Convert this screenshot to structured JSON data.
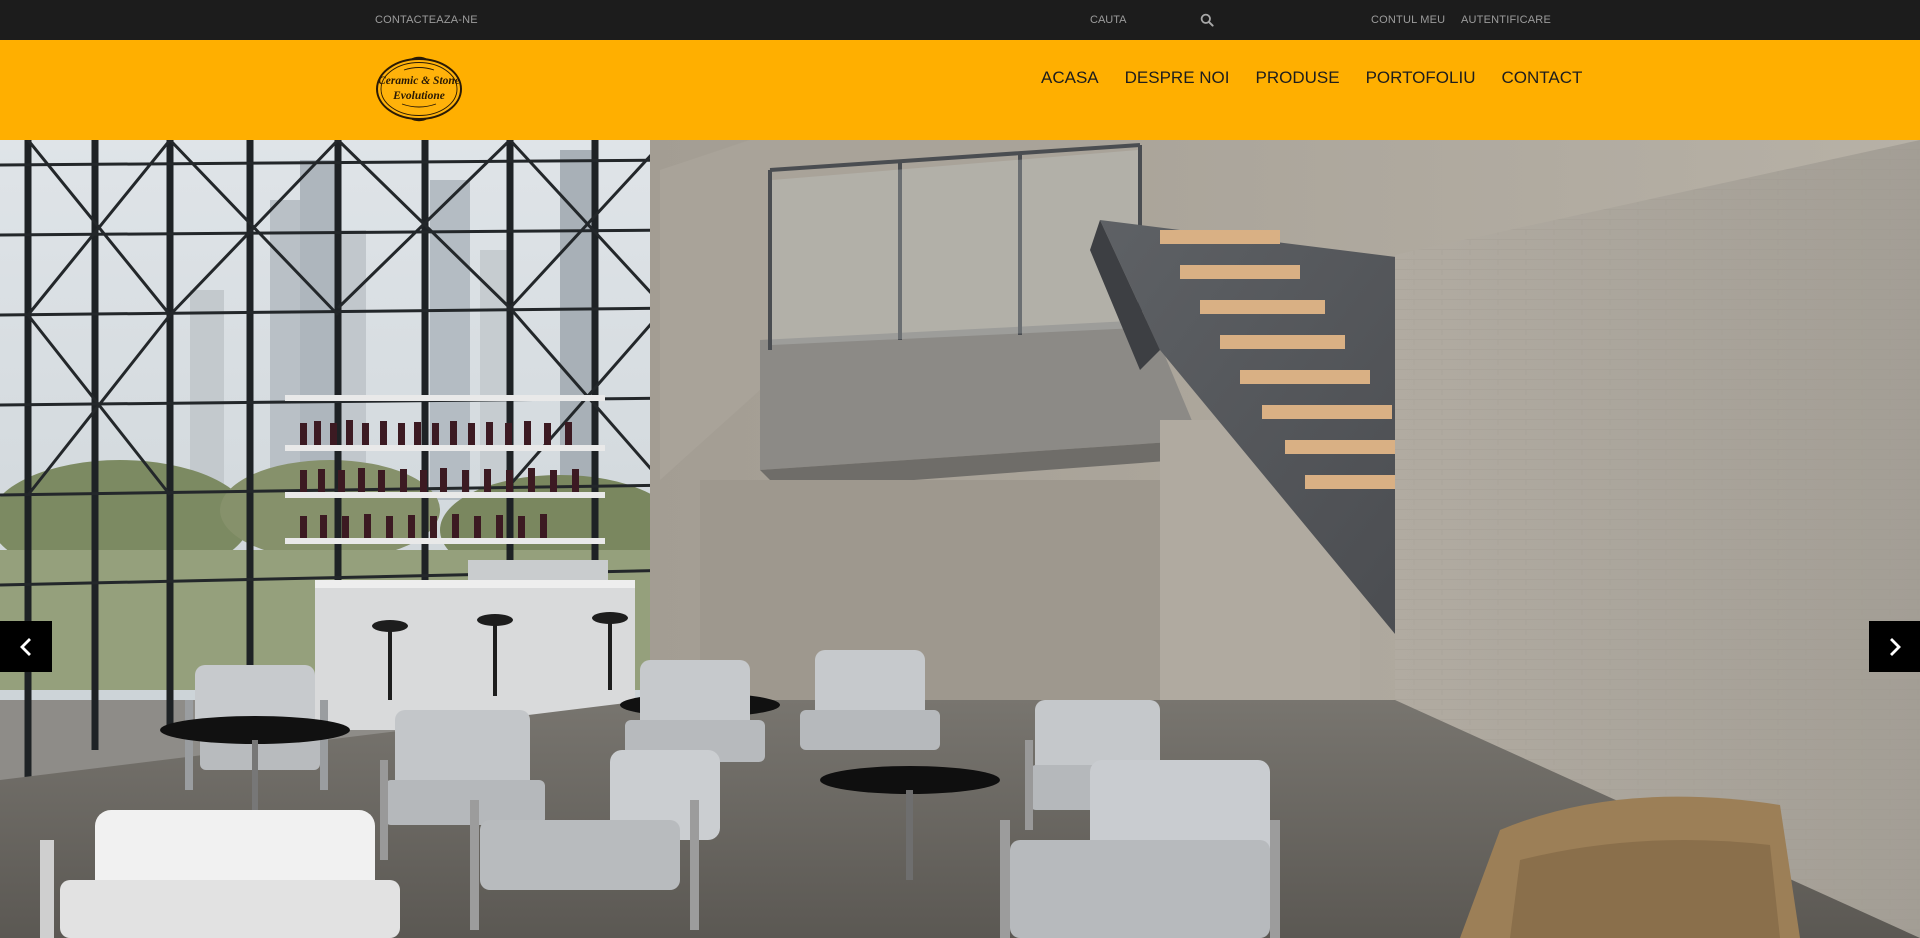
{
  "topbar": {
    "contact_link": "CONTACTEAZA-NE",
    "search_placeholder": "CAUTA",
    "account_link": "CONTUL MEU",
    "login_link": "AUTENTIFICARE"
  },
  "header": {
    "logo": {
      "line1": "Ceramic & Stone",
      "line2": "Evolutione"
    },
    "nav": [
      {
        "label": "ACASA"
      },
      {
        "label": "DESPRE NOI"
      },
      {
        "label": "PRODUSE"
      },
      {
        "label": "PORTOFOLIU"
      },
      {
        "label": "CONTACT"
      }
    ]
  },
  "hero": {
    "prev_icon": "chevron-left-icon",
    "next_icon": "chevron-right-icon"
  },
  "colors": {
    "topbar_bg": "#1c1c1c",
    "header_bg": "#ffaf00",
    "nav_text": "#1d1d1d",
    "arrow_bg": "#000000"
  }
}
